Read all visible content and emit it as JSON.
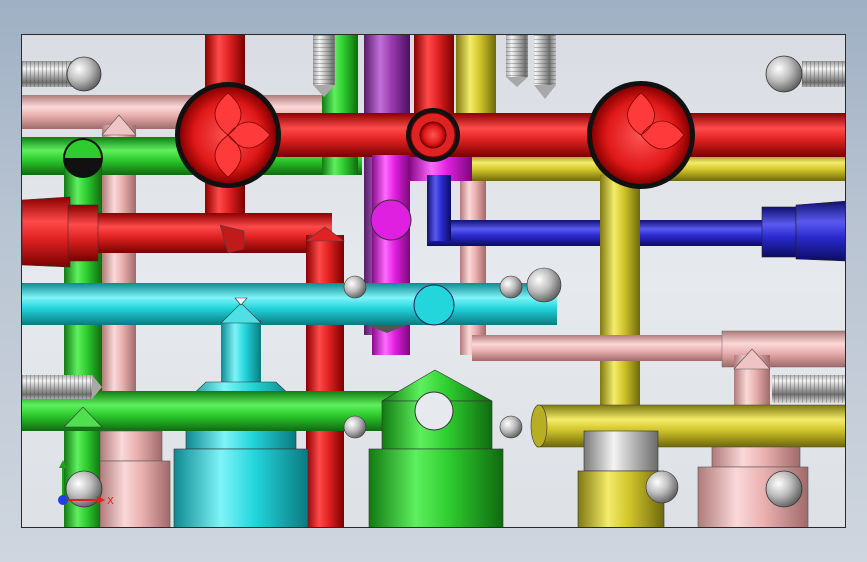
{
  "viewport": {
    "background_top": "#d9dde3",
    "background_bottom": "#dde1e6"
  },
  "triad": {
    "x_label": "X",
    "x_color": "#e02020",
    "y_color": "#20a020",
    "z_color": "#2040e0"
  },
  "palette": {
    "red": "#e02222",
    "green": "#2ecc2e",
    "pink": "#e9b0b0",
    "cyan": "#22d6dc",
    "yellow": "#cfc42a",
    "blue": "#2a2ad0",
    "magenta": "#e020e0",
    "purple": "#9a3ab0",
    "gray": "#c8c8c8"
  },
  "pipes": [
    "red-vertical-left",
    "red-horizontal-top",
    "red-horizontal-middle",
    "red-vertical-mid",
    "green-horizontal-top",
    "green-horizontal-bottom",
    "green-vertical-left",
    "green-vertical-top",
    "pink-horizontal-top",
    "pink-vertical-left",
    "pink-horizontal-right",
    "pink-vertical-right",
    "cyan-horizontal",
    "cyan-vertical",
    "yellow-vertical-top",
    "yellow-horizontal-top",
    "yellow-vertical-right",
    "yellow-horizontal-bottom",
    "blue-horizontal",
    "magenta-vertical",
    "purple-vertical"
  ]
}
